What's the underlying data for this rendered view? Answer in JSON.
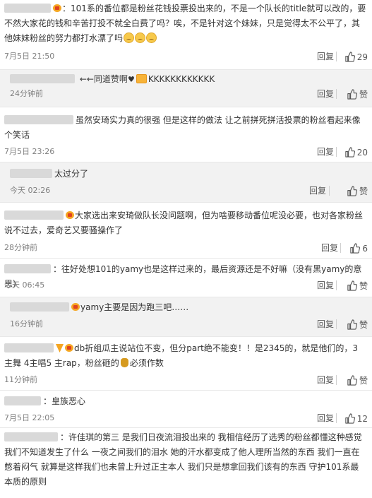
{
  "labels": {
    "reply": "回复",
    "like": "赞"
  },
  "comments": [
    {
      "kind": "top",
      "segments": [
        "：101系的番位都是粉丝花钱投票投出来的，不是一个队长的title就可以改的，要不然大家花的钱和辛苦打投不就全白费了吗？唉，不是针对这个妹妹，只是觉得太不公平了，其他妹妹粉丝的努力都打水漂了吗"
      ],
      "time": "7月5日 21:50",
      "likes": "29"
    },
    {
      "kind": "reply",
      "segments": [
        "←同道赞啊",
        "KKKKKKKKKKKK"
      ],
      "time": "24分钟前",
      "likes": "赞"
    },
    {
      "kind": "top",
      "segments": [
        "虽然安琦实力真的很强 但是这样的做法 让之前拼死拼活投票的粉丝看起来像个笑话"
      ],
      "time": "7月5日 23:26",
      "likes": "20"
    },
    {
      "kind": "reply",
      "segments": [
        "太过分了"
      ],
      "time": "今天 02:26",
      "likes": "赞"
    },
    {
      "kind": "top",
      "segments": [
        "大家选出来安琦做队长没问题啊，但为啥要移动番位呢没必要，也对各家粉丝说不过去，爱奇艺又要骚操作了"
      ],
      "time": "28分钟前",
      "likes": "6"
    },
    {
      "kind": "top",
      "segments": [
        "：往好处想101的yamy也是这样过来的，最后资源还是不好嘛（没有黑yamy的意思）"
      ],
      "time": "今天 06:45",
      "likes": "赞"
    },
    {
      "kind": "reply",
      "segments": [
        "yamy主要是因为跑三吧……"
      ],
      "time": "16分钟前",
      "likes": "赞"
    },
    {
      "kind": "top",
      "segments": [
        "db折组瓜主说站位不变，但分part绝不能变！！是2345的，就是他们的，3主舞 4主唱5 主rap，粉丝砸的",
        "必须作数"
      ],
      "time": "11分钟前",
      "likes": "赞"
    },
    {
      "kind": "top",
      "segments": [
        "：皇族恶心"
      ],
      "time": "7月5日 22:05",
      "likes": "12"
    },
    {
      "kind": "top",
      "segments": [
        "：许佳琪的第三 是我们日夜流泪投出来的 我相信经历了选秀的粉丝都懂这种感觉 我们不知道发生了什么 一夜之间我们的泪水 她的汗水都变成了他人理所当然的东西 我们一直在憋着闷气 就算是这样我们也未曾上升过正主本人 我们只是想拿回我们该有的东西 守护101系最本质的原则"
      ]
    }
  ]
}
